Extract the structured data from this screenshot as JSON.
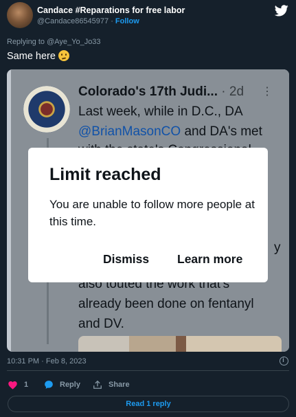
{
  "author": {
    "display_name": "Candace #Reparations for free labor",
    "handle": "@Candace86545977",
    "separator": " · ",
    "follow_label": "Follow"
  },
  "replying_to": "Replying to @Aye_Yo_Jo33",
  "tweet_text": "Same here",
  "tweet_emoji": "thinking-face-emoji",
  "embedded_screenshot": {
    "account_name": "Colorado's 17th Judi...",
    "date": " · 2d",
    "more": "⋮",
    "line1": "Last week, while in D.C., DA",
    "mention": "@BrianMasonCO",
    "line2_rest": " and DA's met",
    "line3_partial": "with the state's Congressional",
    "line_side": "y",
    "line4": "also touted the work that's",
    "line5": "already been done on fentanyl",
    "line6": "and DV."
  },
  "dialog": {
    "title": "Limit reached",
    "body": "You are unable to follow more people at this time.",
    "dismiss_label": "Dismiss",
    "learn_more_label": "Learn more"
  },
  "timestamp": "10:31 PM · Feb 8, 2023",
  "actions": {
    "like_count": "1",
    "reply_label": "Reply",
    "share_label": "Share"
  },
  "read_replies_label": "Read 1 reply",
  "colors": {
    "background": "#15202b",
    "accent": "#1d9bf0",
    "like": "#f91880",
    "muted": "#8899a6"
  }
}
